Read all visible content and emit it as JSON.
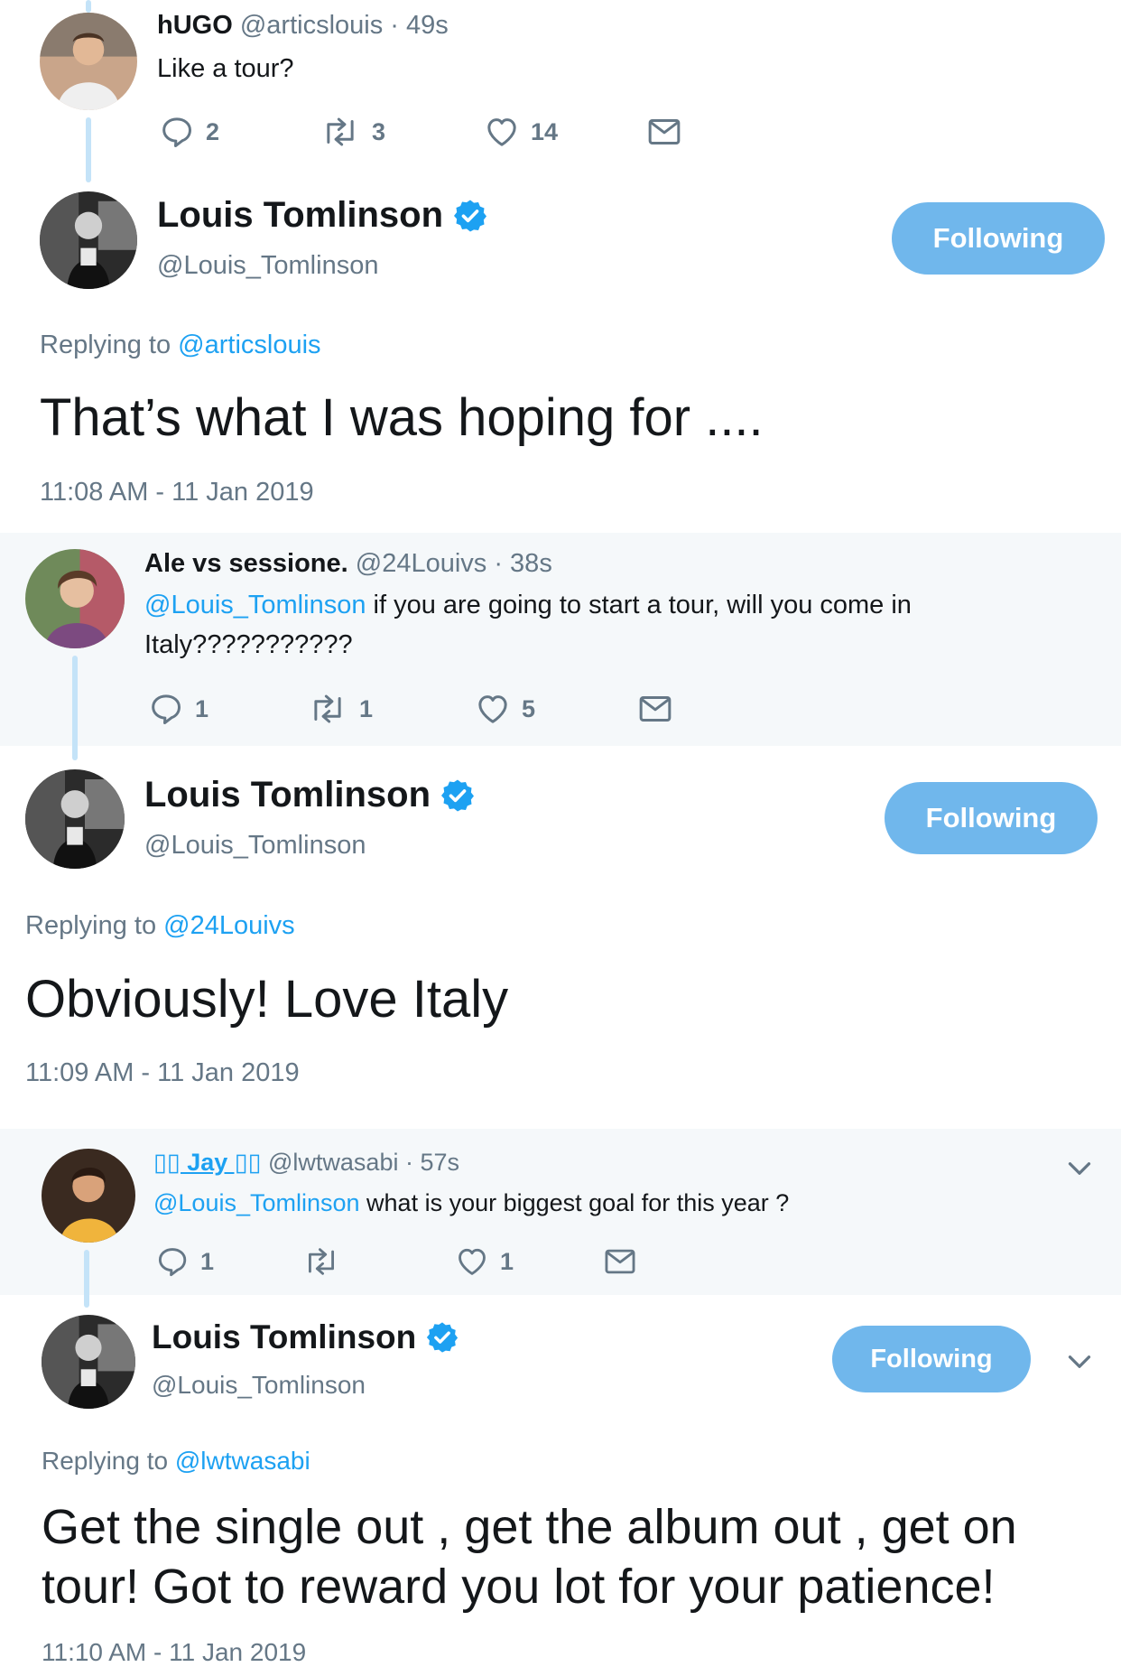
{
  "tweets": [
    {
      "reply": {
        "name": "hUGO",
        "handle": "@articslouis",
        "time": "· 49s",
        "text": "Like a tour?",
        "counts": {
          "reply": "2",
          "retweet": "3",
          "like": "14"
        }
      },
      "main": {
        "name": "Louis Tomlinson",
        "handle": "@Louis_Tomlinson",
        "follow_label": "Following",
        "replying_prefix": "Replying to",
        "replying_handle": "@articslouis",
        "text": "That’s what I was hoping for ....",
        "timestamp": "11:08 AM - 11 Jan 2019"
      }
    },
    {
      "reply": {
        "name": "Ale vs sessione.",
        "handle": "@24Louivs",
        "time": "· 38s",
        "mention": "@Louis_Tomlinson",
        "text": " if you are going to start a tour, will you come in",
        "text2": "Italy???????????",
        "counts": {
          "reply": "1",
          "retweet": "1",
          "like": "5"
        }
      },
      "main": {
        "name": "Louis Tomlinson",
        "handle": "@Louis_Tomlinson",
        "follow_label": "Following",
        "replying_prefix": "Replying to",
        "replying_handle": "@24Louivs",
        "text": "Obviously! Love Italy",
        "timestamp": "11:09 AM - 11 Jan 2019"
      }
    },
    {
      "reply": {
        "name": "▯▯ Jay ▯▯",
        "handle": "@lwtwasabi",
        "time": "· 57s",
        "mention": "@Louis_Tomlinson",
        "text": " what is your biggest goal for this year ?",
        "counts": {
          "reply": "1",
          "retweet": "",
          "like": "1"
        }
      },
      "main": {
        "name": "Louis Tomlinson",
        "handle": "@Louis_Tomlinson",
        "follow_label": "Following",
        "replying_prefix": "Replying to",
        "replying_handle": "@lwtwasabi",
        "text1": "Get the single out , get the album out , get on",
        "text2": "tour! Got to reward you lot for your patience!",
        "timestamp": "11:10 AM - 11 Jan 2019"
      }
    }
  ],
  "colors": {
    "link": "#1da1f2",
    "muted": "#657786",
    "follow_button": "#70b7ec",
    "thread_line": "#c4e3f8",
    "reply_background": "#f5f8fa"
  },
  "icons": [
    "reply-icon",
    "retweet-icon",
    "like-icon",
    "message-icon",
    "verified-badge-icon",
    "chevron-down-icon"
  ]
}
